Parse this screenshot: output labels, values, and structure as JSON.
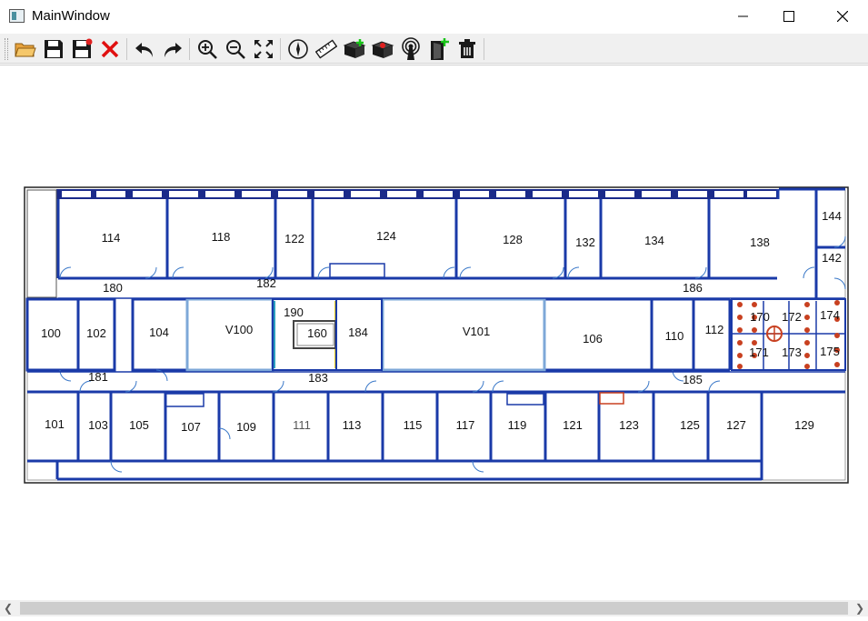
{
  "window": {
    "title": "MainWindow"
  },
  "toolbar": {
    "buttons": [
      {
        "icon": "open-folder-icon"
      },
      {
        "icon": "save-icon"
      },
      {
        "icon": "save-as-icon"
      },
      {
        "icon": "close-x-icon"
      },
      {
        "icon": "undo-icon"
      },
      {
        "icon": "redo-icon"
      },
      {
        "icon": "zoom-in-icon"
      },
      {
        "icon": "zoom-out-icon"
      },
      {
        "icon": "fit-to-window-icon"
      },
      {
        "icon": "compass-icon"
      },
      {
        "icon": "ruler-icon"
      },
      {
        "icon": "add-block-icon"
      },
      {
        "icon": "remove-block-icon"
      },
      {
        "icon": "access-point-icon"
      },
      {
        "icon": "add-door-icon"
      },
      {
        "icon": "delete-icon"
      }
    ]
  },
  "floorplan": {
    "rooms": [
      {
        "label": "114"
      },
      {
        "label": "118"
      },
      {
        "label": "122"
      },
      {
        "label": "124"
      },
      {
        "label": "128"
      },
      {
        "label": "132"
      },
      {
        "label": "134"
      },
      {
        "label": "138"
      },
      {
        "label": "144"
      },
      {
        "label": "142"
      },
      {
        "label": "180"
      },
      {
        "label": "182"
      },
      {
        "label": "186"
      },
      {
        "label": "100"
      },
      {
        "label": "102"
      },
      {
        "label": "104"
      },
      {
        "label": "V100"
      },
      {
        "label": "190"
      },
      {
        "label": "160"
      },
      {
        "label": "184"
      },
      {
        "label": "V101"
      },
      {
        "label": "106"
      },
      {
        "label": "110"
      },
      {
        "label": "112"
      },
      {
        "label": "170"
      },
      {
        "label": "172"
      },
      {
        "label": "174"
      },
      {
        "label": "171"
      },
      {
        "label": "173"
      },
      {
        "label": "175"
      },
      {
        "label": "181"
      },
      {
        "label": "183"
      },
      {
        "label": "185"
      },
      {
        "label": "101"
      },
      {
        "label": "103"
      },
      {
        "label": "105"
      },
      {
        "label": "107"
      },
      {
        "label": "109"
      },
      {
        "label": "111"
      },
      {
        "label": "113"
      },
      {
        "label": "115"
      },
      {
        "label": "117"
      },
      {
        "label": "119"
      },
      {
        "label": "121"
      },
      {
        "label": "123"
      },
      {
        "label": "125"
      },
      {
        "label": "127"
      },
      {
        "label": "129"
      }
    ]
  }
}
